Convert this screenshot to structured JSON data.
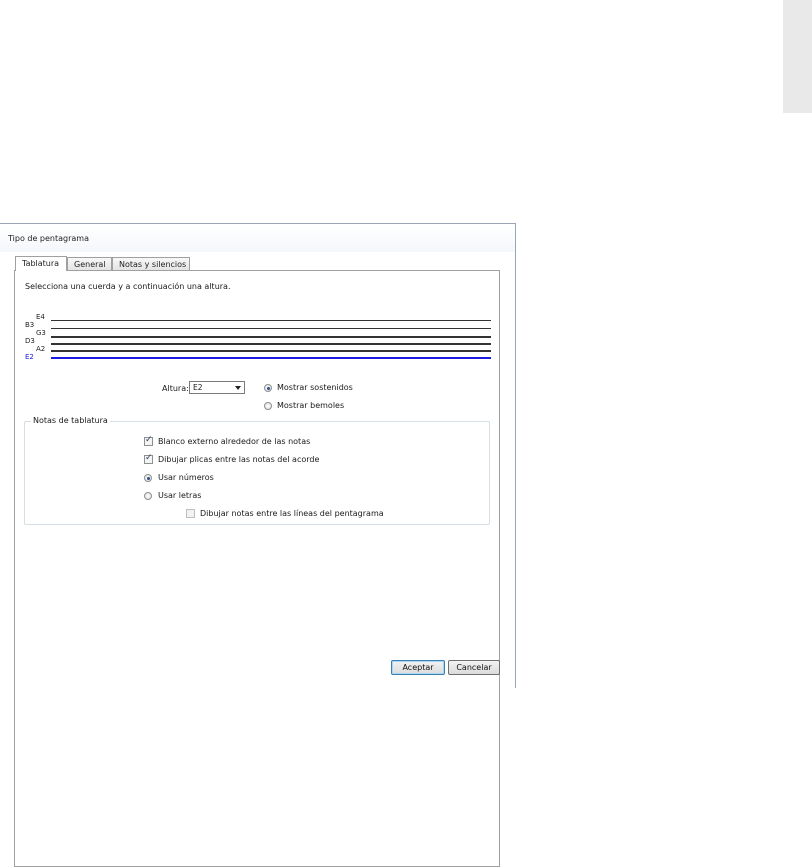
{
  "dialog": {
    "title": "Tipo de pentagrama",
    "tabs": [
      {
        "label": "Tablatura",
        "active": true
      },
      {
        "label": "General",
        "active": false
      },
      {
        "label": "Notas y silencios",
        "active": false
      }
    ]
  },
  "tablature": {
    "instruction": "Selecciona una cuerda y a continuación una altura.",
    "strings": [
      {
        "label": "E4"
      },
      {
        "label": "B3"
      },
      {
        "label": "G3"
      },
      {
        "label": "D3"
      },
      {
        "label": "A2"
      },
      {
        "label": "E2",
        "selected": true,
        "color": "#1a1ae0"
      }
    ],
    "pitch": {
      "label": "Altura:",
      "value": "E2"
    },
    "accidentals": {
      "sharps_label": "Mostrar sostenidos",
      "flats_label": "Mostrar bemoles",
      "selected": "sharps"
    }
  },
  "notes_group": {
    "title": "Notas de tablatura",
    "blank_around_notes": {
      "label": "Blanco externo alrededor de las notas",
      "checked": true
    },
    "draw_stems": {
      "label": "Dibujar plicas entre las notas del acorde",
      "checked": true
    },
    "use_numbers": {
      "label": "Usar números",
      "checked": true
    },
    "use_letters": {
      "label": "Usar letras",
      "checked": false
    },
    "draw_notes_between_lines": {
      "label": "Dibujar notas entre las líneas del pentagrama",
      "checked": false,
      "enabled": false
    }
  },
  "buttons": {
    "accept": "Aceptar",
    "cancel": "Cancelar"
  },
  "colors": {
    "selected_string": "#1a1ae0",
    "accent": "#3c7fb1"
  }
}
